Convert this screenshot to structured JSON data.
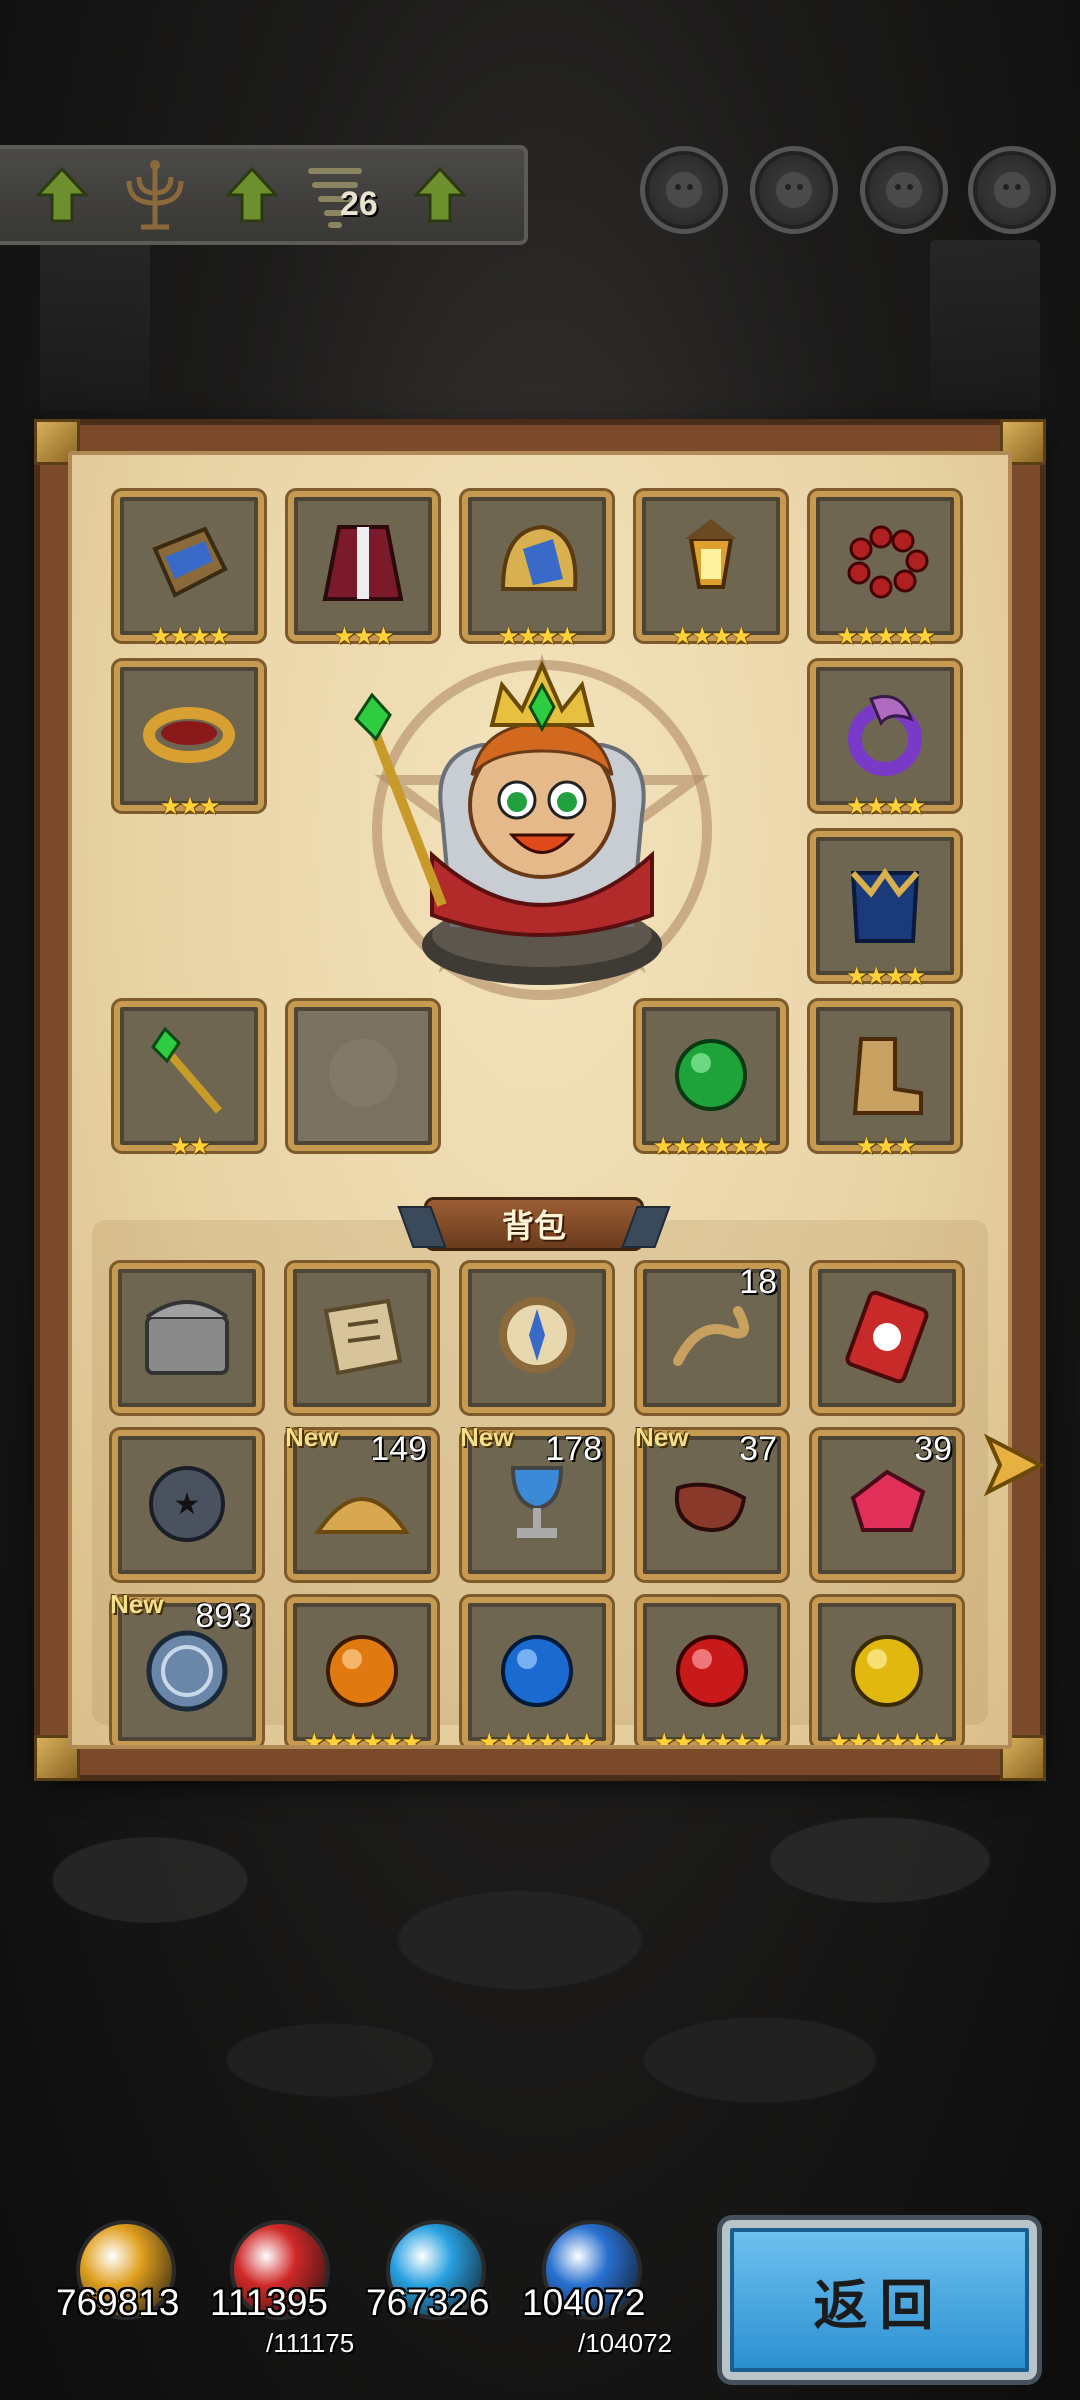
{
  "top_bar": {
    "level_count": "26",
    "icons": [
      "up-arrow-icon",
      "candelabra-icon",
      "up-arrow-icon",
      "tornado-icon",
      "up-arrow-icon"
    ]
  },
  "character_selectors": [
    "hero-1",
    "hero-2",
    "hero-3",
    "hero-4"
  ],
  "equipment": [
    {
      "name": "bracer",
      "stars": "★★★★"
    },
    {
      "name": "robe",
      "stars": "★★★"
    },
    {
      "name": "helmet",
      "stars": "★★★★"
    },
    {
      "name": "lantern",
      "stars": "★★★★"
    },
    {
      "name": "bead-necklace",
      "stars": "★★★★★"
    },
    {
      "name": "ring",
      "stars": "★★★"
    },
    {
      "name": "dragon-ring",
      "stars": "★★★★"
    },
    {
      "name": "armor",
      "stars": "★★★★"
    },
    {
      "name": "emerald-scepter",
      "stars": "★★"
    },
    {
      "name": "empty-slot",
      "stars": ""
    },
    {
      "name": "emerald-orb",
      "stars": "★★★★★★"
    },
    {
      "name": "boots",
      "stars": "★★★"
    }
  ],
  "bag": {
    "title": "背包",
    "items": [
      {
        "name": "treasure-chest",
        "count": "",
        "new": "",
        "stars": ""
      },
      {
        "name": "old-map",
        "count": "",
        "new": "",
        "stars": ""
      },
      {
        "name": "compass",
        "count": "",
        "new": "",
        "stars": ""
      },
      {
        "name": "rope",
        "count": "18",
        "new": "",
        "stars": ""
      },
      {
        "name": "seed-packet",
        "count": "",
        "new": "",
        "stars": ""
      },
      {
        "name": "star-ball",
        "count": "",
        "new": "",
        "stars": ""
      },
      {
        "name": "sand-pile",
        "count": "149",
        "new": "New",
        "stars": ""
      },
      {
        "name": "chalice",
        "count": "178",
        "new": "New",
        "stars": ""
      },
      {
        "name": "horn-flask",
        "count": "37",
        "new": "New",
        "stars": ""
      },
      {
        "name": "red-crystal",
        "count": "39",
        "new": "",
        "stars": ""
      },
      {
        "name": "silver-coin",
        "count": "893",
        "new": "New",
        "stars": ""
      },
      {
        "name": "orange-gem",
        "count": "",
        "new": "",
        "stars": "★★★★★★"
      },
      {
        "name": "blue-gem",
        "count": "",
        "new": "",
        "stars": "★★★★★★"
      },
      {
        "name": "red-gem",
        "count": "",
        "new": "",
        "stars": "★★★★★★"
      },
      {
        "name": "yellow-gem",
        "count": "",
        "new": "",
        "stars": "★★★★★★"
      }
    ]
  },
  "currencies": [
    {
      "name": "gold",
      "value": "769813",
      "max": "",
      "color": "#e0a020"
    },
    {
      "name": "health",
      "value": "111395",
      "max": "/111175",
      "color": "#d02828"
    },
    {
      "name": "mana",
      "value": "767326",
      "max": "",
      "color": "#28a0e0"
    },
    {
      "name": "energy",
      "value": "104072",
      "max": "/104072",
      "color": "#2870d0"
    }
  ],
  "back_button": {
    "label": "返回"
  },
  "colors": {
    "slot_border": "#c79a52",
    "star": "#ffd23a",
    "panel_bg": "#e8d3a4",
    "button_blue": "#2a8fd0"
  }
}
